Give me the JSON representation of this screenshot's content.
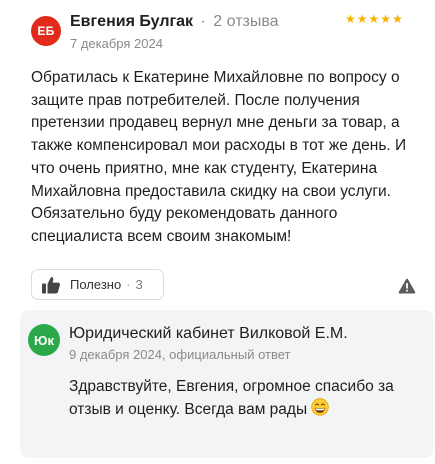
{
  "review": {
    "avatar_initials": "ЕБ",
    "avatar_color": "#e32b1b",
    "author_name": "Евгения Булгак",
    "separator": "·",
    "review_count": "2 отзыва",
    "rating": 5,
    "date": "7 декабря 2024",
    "text": "Обратилась к Екатерине Михайловне по вопросу о защите прав потребителей. После получения претензии продавец вернул мне деньги за товар, а также компенсировал мои расходы в тот же день. И что очень приятно, мне как студенту, Екатерина Михайловна предоставила скидку на свои услуги. Обязательно буду рекомендовать данного специалиста всем своим знакомым!",
    "useful_label": "Полезно",
    "useful_separator": "·",
    "useful_count": "3",
    "icons": {
      "like": "thumbs-up-icon",
      "report": "warning-icon",
      "star": "star-icon"
    },
    "star_color": "#f9b100"
  },
  "reply": {
    "avatar_initials": "Юк",
    "avatar_color": "#2aa84a",
    "title": "Юридический кабинет Вилковой Е.М.",
    "meta": "9 декабря 2024, официальный ответ",
    "text": "Здравствуйте, Евгения, огромное спасибо за отзыв и оценку. Всегда вам рады",
    "emoji": "grinning-face-emoji"
  }
}
